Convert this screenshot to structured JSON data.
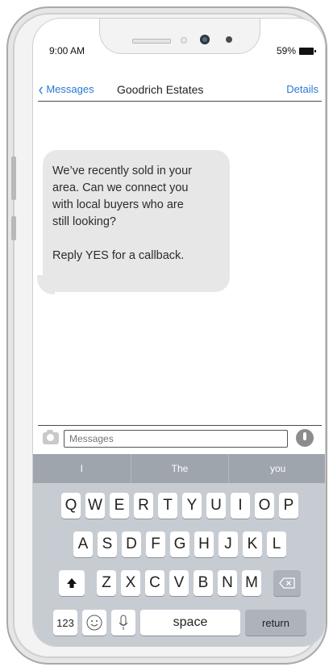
{
  "status_bar": {
    "time": "9:00 AM",
    "battery": "59%"
  },
  "nav": {
    "back_label": "Messages",
    "title": "Goodrich Estates",
    "details_label": "Details"
  },
  "message": {
    "lines": [
      "We’ve recently sold in your",
      "area. Can we connect you",
      "with local buyers who are",
      "still looking?"
    ],
    "footer": "Reply YES for a callback."
  },
  "composer": {
    "placeholder": "Messages"
  },
  "keyboard": {
    "suggestions": [
      "I",
      "The",
      "you"
    ],
    "row1": [
      "Q",
      "W",
      "E",
      "R",
      "T",
      "Y",
      "U",
      "I",
      "O",
      "P"
    ],
    "row2": [
      "A",
      "S",
      "D",
      "F",
      "G",
      "H",
      "J",
      "K",
      "L"
    ],
    "row3": [
      "Z",
      "X",
      "C",
      "V",
      "B",
      "N",
      "M"
    ],
    "numbers_label": "123",
    "space_label": "space",
    "return_label": "return"
  },
  "icons": {
    "back": "chevron-left-icon",
    "camera": "camera-icon",
    "mic": "microphone-icon",
    "shift": "shift-icon",
    "delete": "backspace-icon",
    "emoji": "emoji-icon",
    "dictation": "dictation-icon"
  },
  "colors": {
    "accent": "#2879d6",
    "bubble": "#e7e7e7",
    "keyboard_bg": "#c7cbd2",
    "suggestion_bar": "#9ea5ad"
  }
}
